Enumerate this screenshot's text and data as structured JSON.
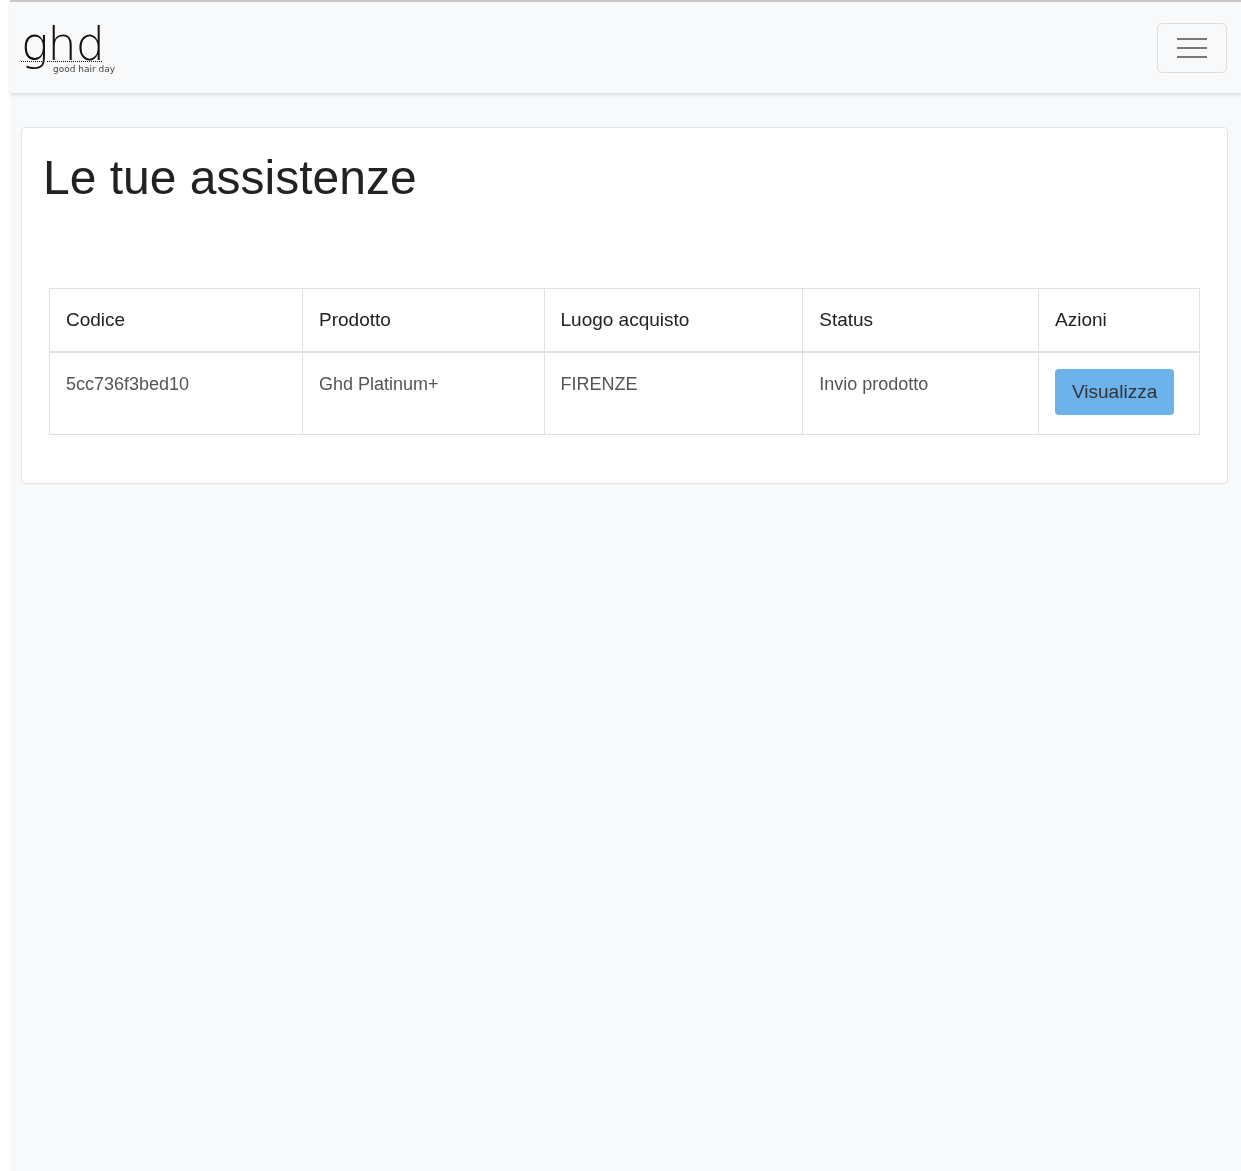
{
  "navbar": {
    "logo": {
      "mark": "ghd",
      "tagline": "good hair day"
    },
    "menu_button": {
      "expanded": false
    }
  },
  "page": {
    "title": "Le tue assistenze"
  },
  "table": {
    "columns": [
      "Codice",
      "Prodotto",
      "Luogo acquisto",
      "Status",
      "Azioni"
    ],
    "rows": [
      {
        "cells": [
          {
            "kind": "text",
            "text": "5cc736f3bed10"
          },
          {
            "kind": "text",
            "text": "Ghd Platinum+"
          },
          {
            "kind": "text",
            "text": "FIRENZE"
          },
          {
            "kind": "text",
            "text": "Invio prodotto"
          },
          {
            "kind": "button",
            "text": "Visualizza"
          }
        ]
      }
    ]
  }
}
